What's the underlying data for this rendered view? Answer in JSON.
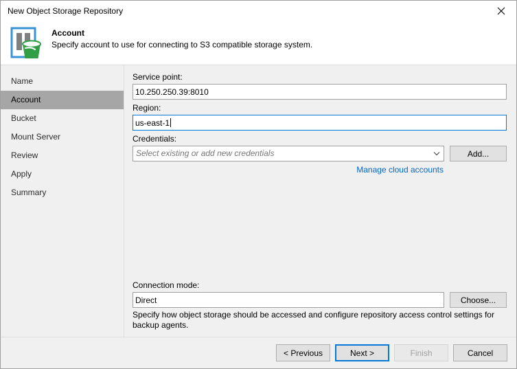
{
  "window": {
    "title": "New Object Storage Repository",
    "close_icon": "close-icon"
  },
  "header": {
    "icon": "object-storage-repository-icon",
    "title": "Account",
    "subtitle": "Specify account to use for connecting to S3 compatible storage system."
  },
  "sidebar": {
    "items": [
      {
        "label": "Name",
        "selected": false
      },
      {
        "label": "Account",
        "selected": true
      },
      {
        "label": "Bucket",
        "selected": false
      },
      {
        "label": "Mount Server",
        "selected": false
      },
      {
        "label": "Review",
        "selected": false
      },
      {
        "label": "Apply",
        "selected": false
      },
      {
        "label": "Summary",
        "selected": false
      }
    ]
  },
  "form": {
    "service_point": {
      "label": "Service point:",
      "value": "10.250.250.39:8010",
      "placeholder": ""
    },
    "region": {
      "label": "Region:",
      "value": "us-east-1",
      "placeholder": "",
      "focused": true
    },
    "credentials": {
      "label": "Credentials:",
      "value": "",
      "placeholder": "Select existing or add new credentials",
      "dropdown_icon": "chevron-down-icon",
      "add_button": "Add..."
    },
    "manage_link": "Manage cloud accounts",
    "connection_mode": {
      "label": "Connection mode:",
      "value": "Direct",
      "choose_button": "Choose...",
      "hint": "Specify how object storage should be accessed and configure repository access control settings for backup agents."
    }
  },
  "footer": {
    "previous": "< Previous",
    "next": "Next >",
    "finish": "Finish",
    "cancel": "Cancel"
  },
  "colors": {
    "accent": "#0078d7",
    "link": "#0066cc",
    "selection": "#a6a6a6",
    "panel": "#f0f0f0",
    "icon_blue": "#3a93d4",
    "icon_green": "#2f9e44",
    "icon_gray": "#808080"
  }
}
